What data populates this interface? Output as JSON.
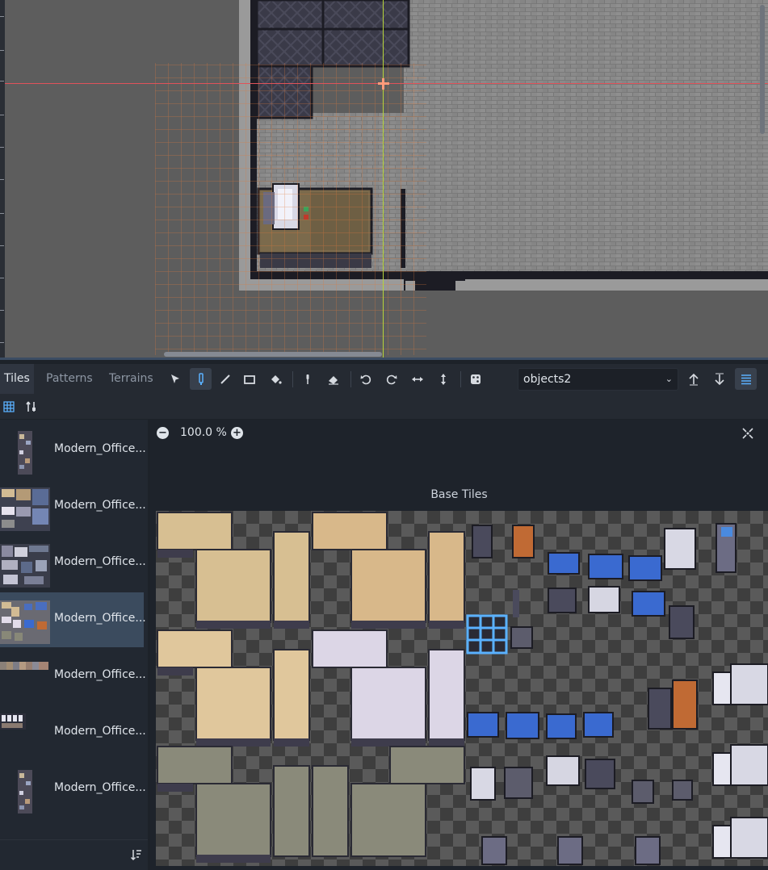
{
  "toolbar": {
    "tabs": [
      "Tiles",
      "Patterns",
      "Terrains"
    ],
    "active_tab": "Tiles",
    "tools": [
      "select-icon",
      "paint-icon",
      "line-icon",
      "rect-icon",
      "bucket-icon",
      "picker-icon",
      "eraser-icon",
      "rotate-left-icon",
      "rotate-right-icon",
      "flip-h-icon",
      "flip-v-icon",
      "random-icon"
    ],
    "layer": "objects2"
  },
  "sources": {
    "items": [
      {
        "label": "Modern_Office..."
      },
      {
        "label": "Modern_Office..."
      },
      {
        "label": "Modern_Office..."
      },
      {
        "label": "Modern_Office..."
      },
      {
        "label": "Modern_Office..."
      },
      {
        "label": "Modern_Office..."
      },
      {
        "label": "Modern_Office..."
      }
    ],
    "selected_index": 3
  },
  "atlas": {
    "zoom": "100.0 %",
    "title": "Base Tiles"
  },
  "colors": {
    "accent": "#5ab1ff",
    "panel": "#222831",
    "selection": "#3b4b5e"
  }
}
